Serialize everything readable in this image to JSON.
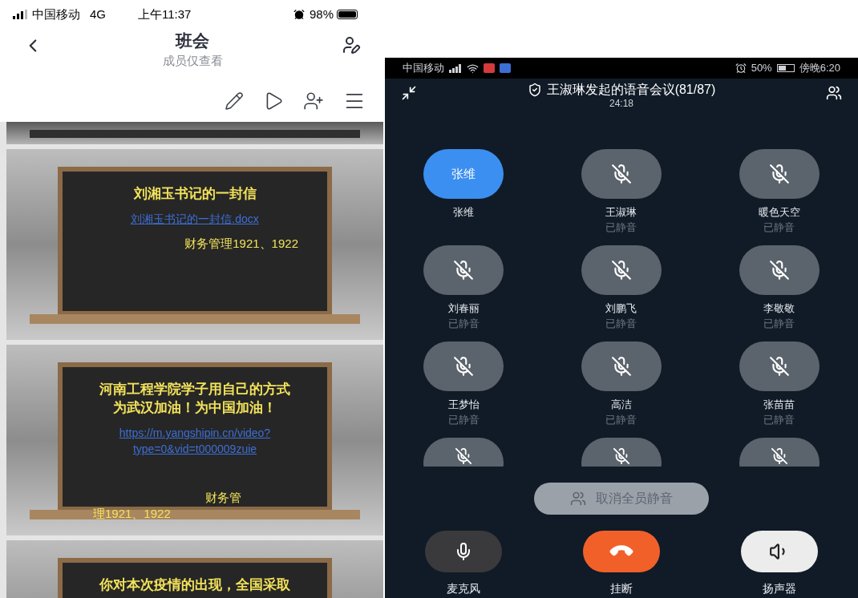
{
  "left_phone": {
    "status_bar": {
      "carrier": "中国移动",
      "network": "4G",
      "time": "上午11:37",
      "battery": "98%"
    },
    "header": {
      "title": "班会",
      "subtitle": "成员仅查看"
    },
    "slides": [
      {
        "kind": "cut_top"
      },
      {
        "kind": "full",
        "title_lines": [
          "刘湘玉书记的一封信"
        ],
        "link_lines": [
          "刘湘玉书记的一封信.docx"
        ],
        "note_lines": [
          "财务管理1921、1922"
        ]
      },
      {
        "kind": "full",
        "title_lines": [
          "河南工程学院学子用自己的方式",
          "为武汉加油！为中国加油！"
        ],
        "link_lines": [
          "https://m.yangshipin.cn/video?",
          "type=0&vid=t000009zuie"
        ],
        "note_lines": [
          "财务管",
          "理1921、1922"
        ]
      },
      {
        "kind": "full",
        "title_lines": [
          "你对本次疫情的出现，全国采取"
        ]
      }
    ]
  },
  "right_phone": {
    "status_bar": {
      "carrier": "中国移动",
      "battery": "50%",
      "time": "傍晚6:20"
    },
    "call": {
      "title": "王淑琳发起的语音会议(81/87)",
      "timer": "24:18"
    },
    "participants": [
      {
        "kind": "initials",
        "avatar_text": "张维",
        "name": "张维",
        "muted": false
      },
      {
        "kind": "photo",
        "name": "王淑琳",
        "muted": true,
        "status": "已静音"
      },
      {
        "kind": "photo",
        "name": "暖色天空",
        "muted": true,
        "status": "已静音"
      },
      {
        "kind": "photo",
        "name": "刘春丽",
        "muted": true,
        "status": "已静音"
      },
      {
        "kind": "photo",
        "name": "刘鹏飞",
        "muted": true,
        "status": "已静音"
      },
      {
        "kind": "photo",
        "name": "李敬敬",
        "muted": true,
        "status": "已静音"
      },
      {
        "kind": "photo",
        "name": "王梦怡",
        "muted": true,
        "status": "已静音"
      },
      {
        "kind": "photo",
        "name": "高洁",
        "muted": true,
        "status": "已静音"
      },
      {
        "kind": "photo",
        "name": "张苗苗",
        "muted": true,
        "status": "已静音"
      }
    ],
    "partial_participants": [
      {
        "muted": true
      },
      {
        "muted": true
      },
      {
        "muted": true
      }
    ],
    "unmute_all": "取消全员静音",
    "controls": [
      {
        "kind": "mic",
        "label": "麦克风"
      },
      {
        "kind": "hangup",
        "label": "挂断"
      },
      {
        "kind": "speaker",
        "label": "扬声器"
      }
    ]
  }
}
